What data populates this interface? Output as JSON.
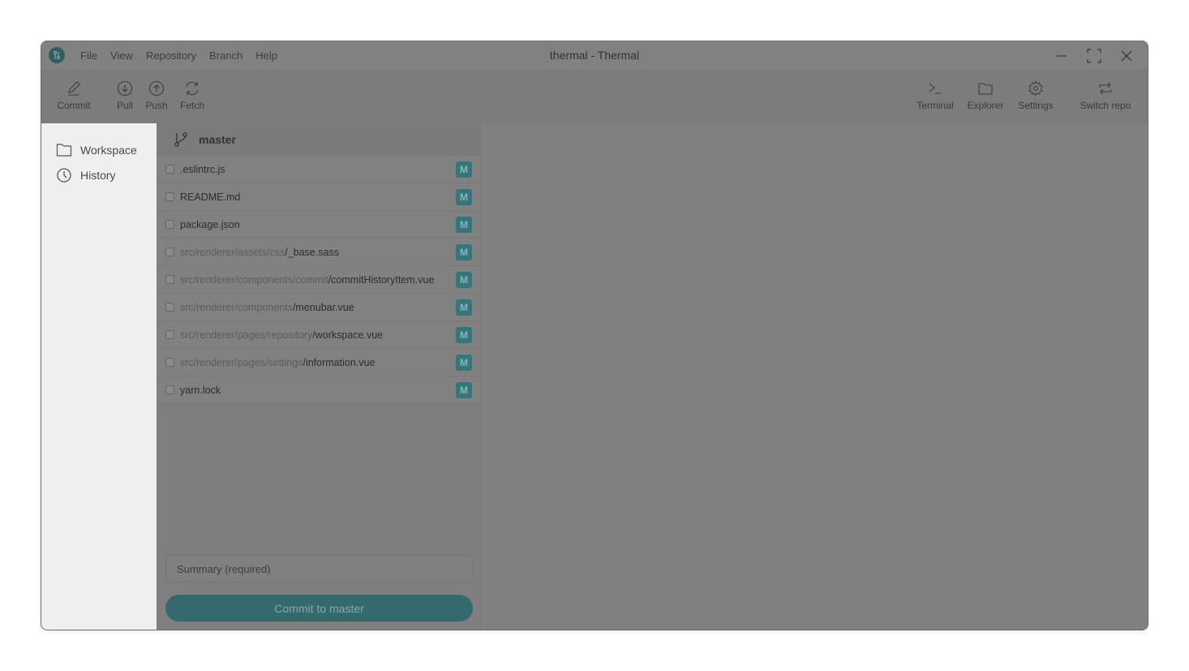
{
  "window": {
    "title": "thermal - Thermal"
  },
  "menubar": {
    "items": [
      {
        "label": "File"
      },
      {
        "label": "View"
      },
      {
        "label": "Repository"
      },
      {
        "label": "Branch"
      },
      {
        "label": "Help"
      }
    ]
  },
  "toolbar": {
    "left": [
      {
        "label": "Commit",
        "icon": "pencil-icon"
      },
      {
        "label": "Pull",
        "icon": "arrow-down-circle-icon"
      },
      {
        "label": "Push",
        "icon": "arrow-up-circle-icon"
      },
      {
        "label": "Fetch",
        "icon": "refresh-icon"
      }
    ],
    "right": [
      {
        "label": "Terminal",
        "icon": "terminal-icon"
      },
      {
        "label": "Explorer",
        "icon": "folder-icon"
      },
      {
        "label": "Settings",
        "icon": "gear-icon"
      },
      {
        "label": "Switch repo",
        "icon": "switch-icon"
      }
    ]
  },
  "sidebar": {
    "items": [
      {
        "label": "Workspace",
        "icon": "folder-icon"
      },
      {
        "label": "History",
        "icon": "clock-icon"
      }
    ]
  },
  "changes": {
    "branch": "master",
    "files": [
      {
        "dir": "",
        "name": ".eslintrc.js",
        "status": "M"
      },
      {
        "dir": "",
        "name": "README.md",
        "status": "M"
      },
      {
        "dir": "",
        "name": "package.json",
        "status": "M"
      },
      {
        "dir": "src/renderer/assets/css",
        "name": "/_base.sass",
        "status": "M"
      },
      {
        "dir": "src/renderer/components/commit",
        "name": "/commitHistoryItem.vue",
        "status": "M"
      },
      {
        "dir": "src/renderer/components",
        "name": "/menubar.vue",
        "status": "M"
      },
      {
        "dir": "src/renderer/pages/repository",
        "name": "/workspace.vue",
        "status": "M"
      },
      {
        "dir": "src/renderer/pages/settings",
        "name": "/information.vue",
        "status": "M"
      },
      {
        "dir": "",
        "name": "yarn.lock",
        "status": "M"
      }
    ],
    "summary_placeholder": "Summary (required)",
    "summary_value": "",
    "commit_button": "Commit to master"
  },
  "colors": {
    "accent": "#33777a",
    "scrim": "#808080",
    "sidebar_bg": "#efefef"
  }
}
